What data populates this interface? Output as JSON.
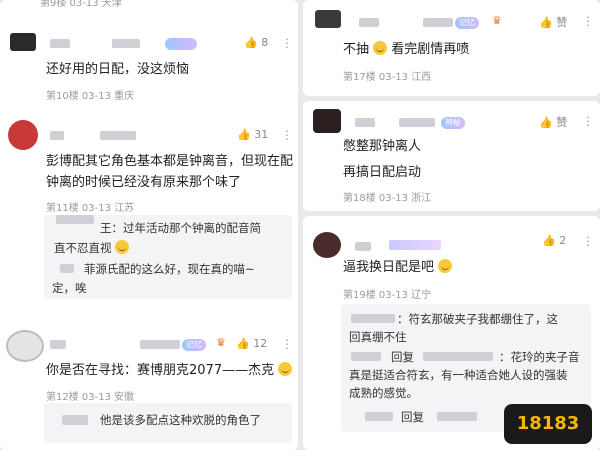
{
  "left": {
    "top_meta": "第9楼 03-13 天津",
    "c1": {
      "likes": "8",
      "text": "还好用的日配，没这烦恼",
      "meta": "第10楼 03-13 重庆"
    },
    "c2": {
      "likes": "31",
      "text_l1": "彭博配其它角色基本都是钟离音，但现在配",
      "text_l2": "钟离的时候已经没有原来那个味了",
      "meta": "第11楼 03-13 江苏",
      "r1_a": "王：过年活动那个钟离的配音简",
      "r1_b": "直不忍直视",
      "r2_a": "菲源氏配的这么好，现在真的喵~",
      "r2_b": "定，唉"
    },
    "c3": {
      "likes": "12",
      "badge": "记忆",
      "text": "你是否在寻找：赛博朋克2077——杰克",
      "meta": "第12楼 03-13 安徽",
      "r1": "他是该多配点这种欢脱的角色了"
    }
  },
  "right": {
    "c1": {
      "badge": "记忆",
      "likes": "赞",
      "text": "不抽",
      "text_after": "看完剧情再喷",
      "meta": "第17楼 03-13 江西"
    },
    "c2": {
      "badge": "神秘",
      "likes": "赞",
      "text_l1": "憋整那钟离人",
      "text_l2": "再搞日配启动",
      "meta": "第18楼 03-13 浙江"
    },
    "c3": {
      "likes": "2",
      "text": "逼我换日配是吧",
      "meta": "第19楼 03-13 辽宁",
      "r1_a": "：符玄那破夹子我都绷住了，这",
      "r1_b": "回真绷不住",
      "r2_a": "回复",
      "r2_b": "：花玲的夹子音",
      "r2_c": "真是挺适合符玄，有一种适合她人设的强装",
      "r2_d": "成熟的感觉。",
      "r3": "回复"
    }
  },
  "logo": "18183",
  "icons": {
    "like": "thumb-up-icon",
    "more": "more-dots-icon",
    "avatar": "avatar",
    "logo": "site-logo"
  }
}
